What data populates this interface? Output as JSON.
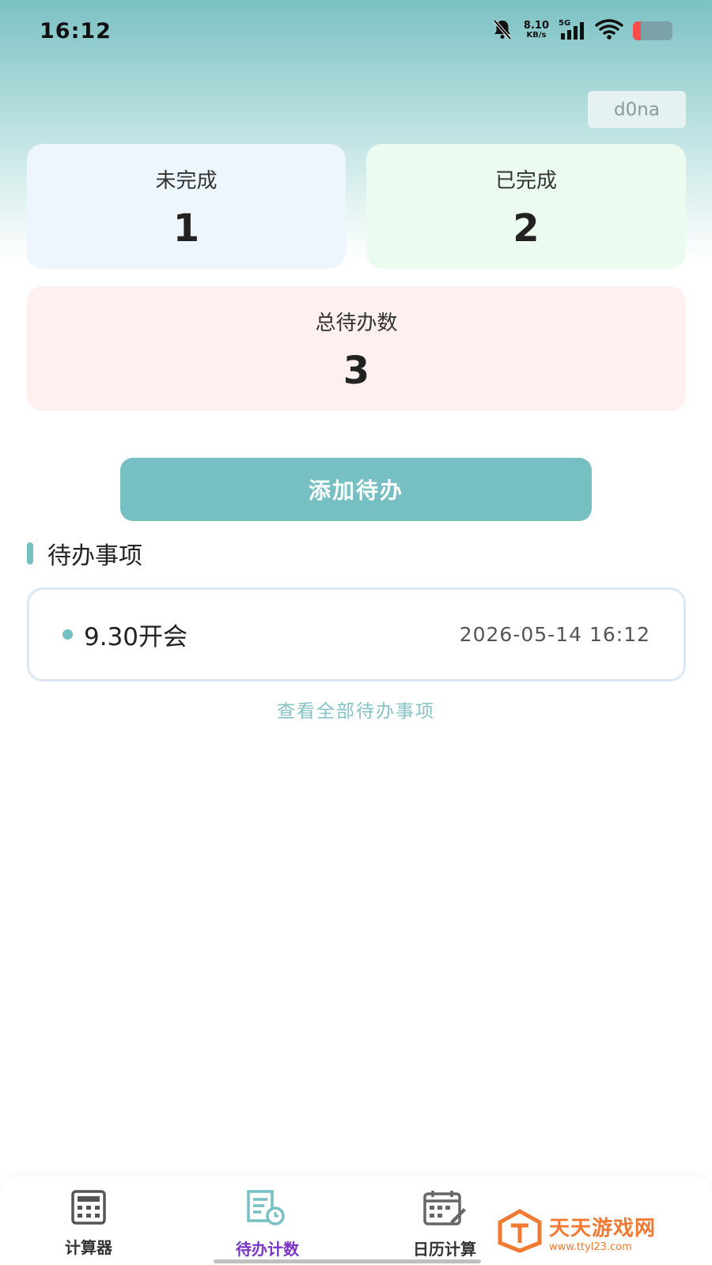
{
  "status_bar": {
    "time": "16:12",
    "net_speed_value": "8.10",
    "net_speed_unit": "KB/s",
    "network_type": "5G"
  },
  "user": {
    "name": "d0na"
  },
  "stats": {
    "pending_label": "未完成",
    "pending_count": "1",
    "done_label": "已完成",
    "done_count": "2",
    "total_label": "总待办数",
    "total_count": "3"
  },
  "actions": {
    "add_label": "添加待办"
  },
  "section": {
    "title": "待办事项"
  },
  "todos": [
    {
      "title": "9.30开会",
      "time": "2026-05-14 16:12"
    }
  ],
  "view_all_label": "查看全部待办事项",
  "nav": {
    "items": [
      {
        "label": "计算器",
        "icon": "calculator-icon"
      },
      {
        "label": "待办计数",
        "icon": "todo-icon",
        "active": true
      },
      {
        "label": "日历计算",
        "icon": "calendar-icon"
      }
    ]
  },
  "watermark": {
    "name": "天天游戏网",
    "url": "www.ttyl23.com"
  },
  "colors": {
    "accent": "#76bfc2",
    "active_nav": "#7a34c8",
    "pending_bg": "#eef6fd",
    "done_bg": "#ecfbef",
    "total_bg": "#fdf0ef",
    "watermark": "#f07a32"
  }
}
